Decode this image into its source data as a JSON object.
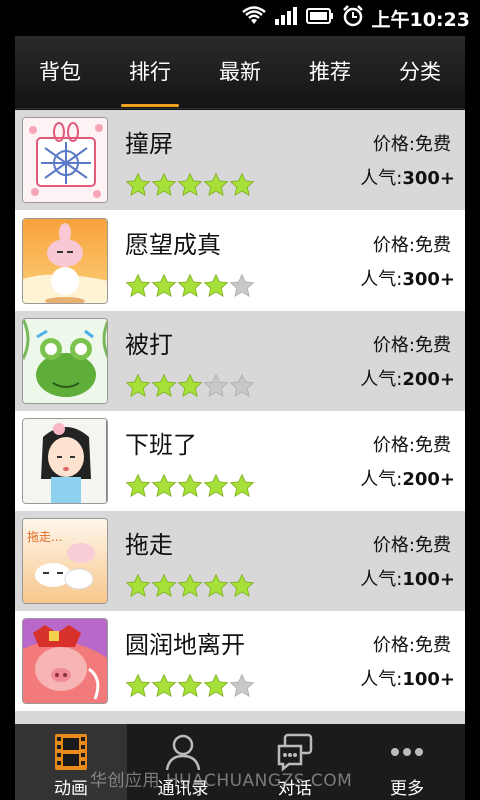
{
  "status_bar": {
    "time": "上午10:23"
  },
  "tabs": [
    {
      "label": "背包"
    },
    {
      "label": "排行",
      "active": true
    },
    {
      "label": "最新"
    },
    {
      "label": "推荐"
    },
    {
      "label": "分类"
    }
  ],
  "items": [
    {
      "name": "撞屏",
      "price_label": "价格:",
      "price": "免费",
      "pop_label": "人气:",
      "popularity": "300+",
      "rating": 5
    },
    {
      "name": "愿望成真",
      "price_label": "价格:",
      "price": "免费",
      "pop_label": "人气:",
      "popularity": "300+",
      "rating": 4
    },
    {
      "name": "被打",
      "price_label": "价格:",
      "price": "免费",
      "pop_label": "人气:",
      "popularity": "200+",
      "rating": 3
    },
    {
      "name": "下班了",
      "price_label": "价格:",
      "price": "免费",
      "pop_label": "人气:",
      "popularity": "200+",
      "rating": 5
    },
    {
      "name": "拖走",
      "price_label": "价格:",
      "price": "免费",
      "pop_label": "人气:",
      "popularity": "100+",
      "rating": 5
    },
    {
      "name": "圆润地离开",
      "price_label": "价格:",
      "price": "免费",
      "pop_label": "人气:",
      "popularity": "100+",
      "rating": 4
    }
  ],
  "bottom_nav": [
    {
      "label": "动画",
      "icon": "film-icon",
      "active": true
    },
    {
      "label": "通讯录",
      "icon": "contact-icon"
    },
    {
      "label": "对话",
      "icon": "chat-icon"
    },
    {
      "label": "更多",
      "icon": "more-icon"
    }
  ],
  "watermark": "华创应用 HUACHUANGZS.COM",
  "thumb_text": "拖走...",
  "colors": {
    "tab_indicator": "#f0a020",
    "star_on": "#a8e03a",
    "star_off": "#c8c8c8",
    "row_alt": "#d8d8d8"
  }
}
